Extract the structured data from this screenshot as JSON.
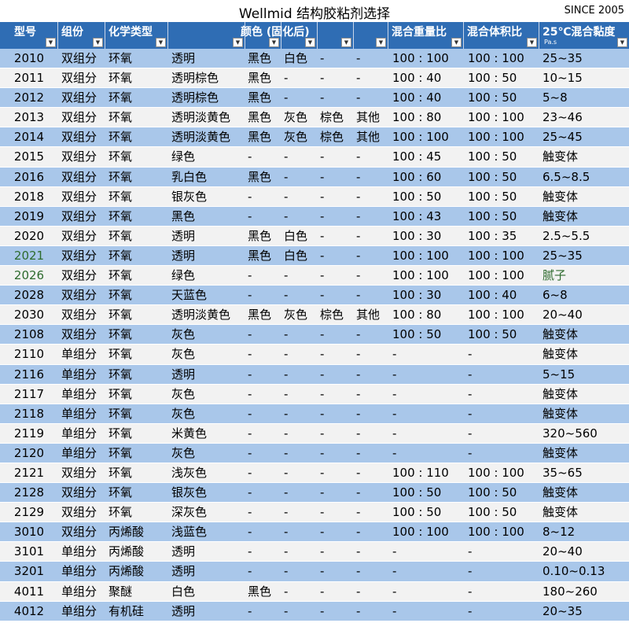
{
  "title": "Wellmid 结构胶粘剂选择",
  "since": "SINCE 2005",
  "headers": {
    "model": "型号",
    "components": "组份",
    "chem": "化学类型",
    "color": "颜色 (固化后)",
    "weight_ratio": "混合重量比",
    "volume_ratio": "混合体积比",
    "viscosity": "25℃混合黏度",
    "viscosity_unit": "Pa.s"
  },
  "filter_icon": "dropdown-arrow-icon",
  "colors": {
    "header_bg": "#2f6db4",
    "row_odd": "#a9c7ea",
    "row_even": "#f2f2f2",
    "green_text": "#2e6b2e"
  },
  "rows": [
    {
      "model": "2010",
      "comp": "双组分",
      "chem": "环氧",
      "color": "透明",
      "c1": "黑色",
      "c2": "白色",
      "c3": "-",
      "c4": "-",
      "weight": "100 : 100",
      "volume": "100 : 100",
      "visc": "25~35"
    },
    {
      "model": "2011",
      "comp": "双组分",
      "chem": "环氧",
      "color": "透明棕色",
      "c1": "黑色",
      "c2": "-",
      "c3": "-",
      "c4": "-",
      "weight": "100 : 40",
      "volume": "100 : 50",
      "visc": "10~15"
    },
    {
      "model": "2012",
      "comp": "双组分",
      "chem": "环氧",
      "color": "透明棕色",
      "c1": "黑色",
      "c2": "-",
      "c3": "-",
      "c4": "-",
      "weight": "100 : 40",
      "volume": "100 : 50",
      "visc": "5~8"
    },
    {
      "model": "2013",
      "comp": "双组分",
      "chem": "环氧",
      "color": "透明淡黄色",
      "c1": "黑色",
      "c2": "灰色",
      "c3": "棕色",
      "c4": "其他",
      "weight": "100 : 80",
      "volume": "100 : 100",
      "visc": "23~46"
    },
    {
      "model": "2014",
      "comp": "双组分",
      "chem": "环氧",
      "color": "透明淡黄色",
      "c1": "黑色",
      "c2": "灰色",
      "c3": "棕色",
      "c4": "其他",
      "weight": "100 : 100",
      "volume": "100 : 100",
      "visc": "25~45"
    },
    {
      "model": "2015",
      "comp": "双组分",
      "chem": "环氧",
      "color": "绿色",
      "c1": "-",
      "c2": "-",
      "c3": "-",
      "c4": "-",
      "weight": "100 : 45",
      "volume": "100 : 50",
      "visc": "触变体"
    },
    {
      "model": "2016",
      "comp": "双组分",
      "chem": "环氧",
      "color": "乳白色",
      "c1": "黑色",
      "c2": "-",
      "c3": "-",
      "c4": "-",
      "weight": "100 : 60",
      "volume": "100 : 50",
      "visc": "6.5~8.5"
    },
    {
      "model": "2018",
      "comp": "双组分",
      "chem": "环氧",
      "color": "银灰色",
      "c1": "-",
      "c2": "-",
      "c3": "-",
      "c4": "-",
      "weight": "100 : 50",
      "volume": "100 : 50",
      "visc": "触变体"
    },
    {
      "model": "2019",
      "comp": "双组分",
      "chem": "环氧",
      "color": "黑色",
      "c1": "-",
      "c2": "-",
      "c3": "-",
      "c4": "-",
      "weight": "100 : 43",
      "volume": "100 : 50",
      "visc": "触变体"
    },
    {
      "model": "2020",
      "comp": "双组分",
      "chem": "环氧",
      "color": "透明",
      "c1": "黑色",
      "c2": "白色",
      "c3": "-",
      "c4": "-",
      "weight": "100 : 30",
      "volume": "100 : 35",
      "visc": "2.5~5.5"
    },
    {
      "model": "2021",
      "comp": "双组分",
      "chem": "环氧",
      "color": "透明",
      "c1": "黑色",
      "c2": "白色",
      "c3": "-",
      "c4": "-",
      "weight": "100 : 100",
      "volume": "100 : 100",
      "visc": "25~35",
      "green_model": true
    },
    {
      "model": "2026",
      "comp": "双组分",
      "chem": "环氧",
      "color": "绿色",
      "c1": "-",
      "c2": "-",
      "c3": "-",
      "c4": "-",
      "weight": "100 : 100",
      "volume": "100 : 100",
      "visc": "腻子",
      "green_model": true,
      "green_visc": true
    },
    {
      "model": "2028",
      "comp": "双组分",
      "chem": "环氧",
      "color": "天蓝色",
      "c1": "-",
      "c2": "-",
      "c3": "-",
      "c4": "-",
      "weight": "100 : 30",
      "volume": "100 : 40",
      "visc": "6~8"
    },
    {
      "model": "2030",
      "comp": "双组分",
      "chem": "环氧",
      "color": "透明淡黄色",
      "c1": "黑色",
      "c2": "灰色",
      "c3": "棕色",
      "c4": "其他",
      "weight": "100 : 80",
      "volume": "100 : 100",
      "visc": "20~40"
    },
    {
      "model": "2108",
      "comp": "双组分",
      "chem": "环氧",
      "color": "灰色",
      "c1": "-",
      "c2": "-",
      "c3": "-",
      "c4": "-",
      "weight": "100 : 50",
      "volume": "100 : 50",
      "visc": "触变体"
    },
    {
      "model": "2110",
      "comp": "单组分",
      "chem": "环氧",
      "color": "灰色",
      "c1": "-",
      "c2": "-",
      "c3": "-",
      "c4": "-",
      "weight": "-",
      "volume": "-",
      "visc": "触变体"
    },
    {
      "model": "2116",
      "comp": "单组分",
      "chem": "环氧",
      "color": "透明",
      "c1": "-",
      "c2": "-",
      "c3": "-",
      "c4": "-",
      "weight": "-",
      "volume": "-",
      "visc": "5~15"
    },
    {
      "model": "2117",
      "comp": "单组分",
      "chem": "环氧",
      "color": "灰色",
      "c1": "-",
      "c2": "-",
      "c3": "-",
      "c4": "-",
      "weight": "-",
      "volume": "-",
      "visc": "触变体"
    },
    {
      "model": "2118",
      "comp": "单组分",
      "chem": "环氧",
      "color": "灰色",
      "c1": "-",
      "c2": "-",
      "c3": "-",
      "c4": "-",
      "weight": "-",
      "volume": "-",
      "visc": "触变体"
    },
    {
      "model": "2119",
      "comp": "单组分",
      "chem": "环氧",
      "color": "米黄色",
      "c1": "-",
      "c2": "-",
      "c3": "-",
      "c4": "-",
      "weight": "-",
      "volume": "-",
      "visc": "320~560"
    },
    {
      "model": "2120",
      "comp": "单组分",
      "chem": "环氧",
      "color": "灰色",
      "c1": "-",
      "c2": "-",
      "c3": "-",
      "c4": "-",
      "weight": "-",
      "volume": "-",
      "visc": "触变体"
    },
    {
      "model": "2121",
      "comp": "双组分",
      "chem": "环氧",
      "color": "浅灰色",
      "c1": "-",
      "c2": "-",
      "c3": "-",
      "c4": "-",
      "weight": "100 : 110",
      "volume": "100 : 100",
      "visc": "35~65"
    },
    {
      "model": "2128",
      "comp": "双组分",
      "chem": "环氧",
      "color": "银灰色",
      "c1": "-",
      "c2": "-",
      "c3": "-",
      "c4": "-",
      "weight": "100 : 50",
      "volume": "100 : 50",
      "visc": "触变体"
    },
    {
      "model": "2129",
      "comp": "双组分",
      "chem": "环氧",
      "color": "深灰色",
      "c1": "-",
      "c2": "-",
      "c3": "-",
      "c4": "-",
      "weight": "100 : 50",
      "volume": "100 : 50",
      "visc": "触变体"
    },
    {
      "model": "3010",
      "comp": "双组分",
      "chem": "丙烯酸",
      "color": "浅蓝色",
      "c1": "-",
      "c2": "-",
      "c3": "-",
      "c4": "-",
      "weight": "100 : 100",
      "volume": "100 : 100",
      "visc": "8~12"
    },
    {
      "model": "3101",
      "comp": "单组分",
      "chem": "丙烯酸",
      "color": "透明",
      "c1": "-",
      "c2": "-",
      "c3": "-",
      "c4": "-",
      "weight": "-",
      "volume": "-",
      "visc": "20~40"
    },
    {
      "model": "3201",
      "comp": "单组分",
      "chem": "丙烯酸",
      "color": "透明",
      "c1": "-",
      "c2": "-",
      "c3": "-",
      "c4": "-",
      "weight": "-",
      "volume": "-",
      "visc": "0.10~0.13"
    },
    {
      "model": "4011",
      "comp": "单组分",
      "chem": "聚醚",
      "color": "白色",
      "c1": "黑色",
      "c2": "-",
      "c3": "-",
      "c4": "-",
      "weight": "-",
      "volume": "-",
      "visc": "180~260"
    },
    {
      "model": "4012",
      "comp": "单组分",
      "chem": "有机硅",
      "color": "透明",
      "c1": "-",
      "c2": "-",
      "c3": "-",
      "c4": "-",
      "weight": "-",
      "volume": "-",
      "visc": "20~35"
    }
  ]
}
